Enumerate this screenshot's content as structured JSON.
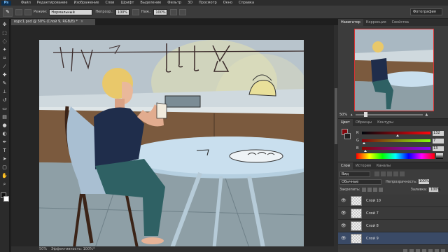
{
  "app": {
    "logo": "Ps"
  },
  "menu": [
    "Файл",
    "Редактирование",
    "Изображение",
    "Слои",
    "Шрифт",
    "Выделение",
    "Фильтр",
    "3D",
    "Просмотр",
    "Окно",
    "Справка"
  ],
  "options": {
    "mode_label": "Режим:",
    "mode_value": "Нормальный",
    "opacity_label": "Непрозр.:",
    "opacity_value": "100%",
    "pressure_label": "Наж.:",
    "pressure_value": "100%",
    "workspace": "Фотография"
  },
  "document": {
    "tab_title": "вурс1.psd @ 50% (Слой 9, RGB/8) *",
    "status_zoom": "50%",
    "status_text": "Эффективность: 100%*"
  },
  "navigator": {
    "tabs": [
      "Навигатор",
      "Коррекция",
      "Свойства"
    ],
    "zoom": "50%"
  },
  "color_panel": {
    "tabs": [
      "Цвет",
      "Образцы",
      "Контуры"
    ],
    "channels": [
      {
        "name": "R",
        "value": "132"
      },
      {
        "name": "G",
        "value": "7"
      },
      {
        "name": "B",
        "value": "13"
      }
    ],
    "current_color": "#84070d"
  },
  "layers_panel": {
    "tabs": [
      "Слои",
      "История",
      "Каналы"
    ],
    "filter_label": "Вид",
    "blend_mode": "Обычные",
    "opacity_label": "Непрозрачность:",
    "opacity_value": "100%",
    "lock_label": "Закрепить:",
    "fill_label": "Заливка:",
    "fill_value": "100%",
    "layers": [
      {
        "name": "Слой 10",
        "selected": false
      },
      {
        "name": "Слой 7",
        "selected": false
      },
      {
        "name": "Слой 8",
        "selected": false
      },
      {
        "name": "Слой 9",
        "selected": true
      }
    ]
  }
}
